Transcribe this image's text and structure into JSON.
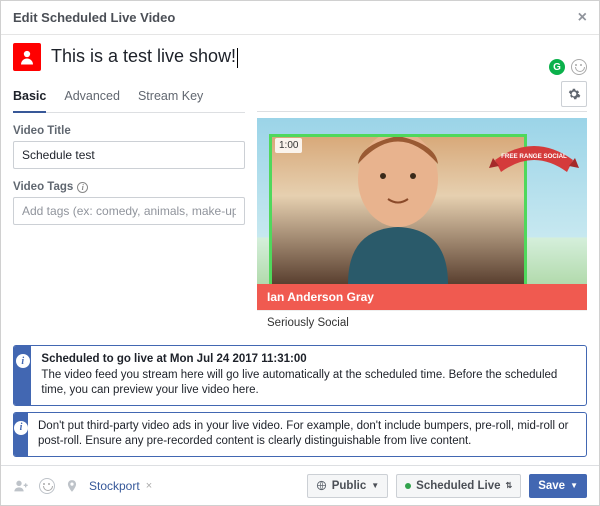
{
  "header": {
    "title": "Edit Scheduled Live Video"
  },
  "composer": {
    "post_text": "This is a test live show!"
  },
  "tabs": {
    "basic": "Basic",
    "advanced": "Advanced",
    "stream_key": "Stream Key"
  },
  "form": {
    "video_title_label": "Video Title",
    "video_title_value": "Schedule test",
    "video_tags_label": "Video Tags",
    "video_tags_placeholder": "Add tags (ex: comedy, animals, make-up etc."
  },
  "preview": {
    "time_badge": "1:00",
    "banner_text": "FREE RANGE SOCIAL",
    "lower_third_name": "Ian Anderson Gray",
    "lower_third_sub": "Seriously Social"
  },
  "notices": {
    "n1_title": "Scheduled to go live at Mon Jul 24 2017 11:31:00",
    "n1_body": "The video feed you stream here will go live automatically at the scheduled time. Before the scheduled time, you can preview your live video here.",
    "n2_body": "Don't put third-party video ads in your live video. For example, don't include bumpers, pre-roll, mid-roll or post-roll. Ensure any pre-recorded content is clearly distinguishable from live content."
  },
  "footer": {
    "location": "Stockport",
    "privacy_label": "Public",
    "status_label": "Scheduled Live",
    "save_label": "Save"
  }
}
